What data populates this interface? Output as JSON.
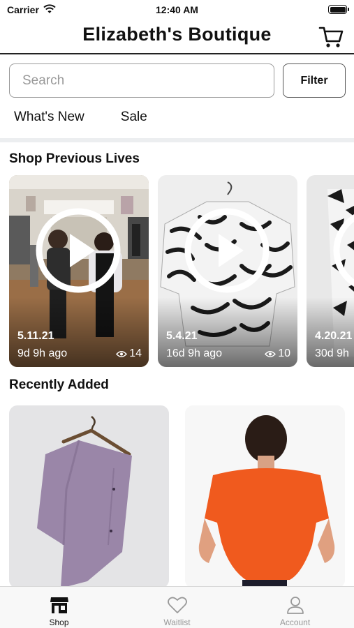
{
  "status_bar": {
    "carrier": "Carrier",
    "time": "12:40 AM"
  },
  "header": {
    "title": "Elizabeth's Boutique",
    "cart_icon": "cart-icon"
  },
  "search": {
    "placeholder": "Search",
    "filter_label": "Filter"
  },
  "top_tabs": [
    {
      "label": "What's New"
    },
    {
      "label": "Sale"
    }
  ],
  "previous_lives": {
    "title": "Shop Previous Lives",
    "items": [
      {
        "date": "5.11.21",
        "ago": "9d 9h ago",
        "views": "14"
      },
      {
        "date": "5.4.21",
        "ago": "16d 9h ago",
        "views": "10"
      },
      {
        "date": "4.20.21",
        "ago": "30d 9h",
        "views": ""
      }
    ]
  },
  "recently_added": {
    "title": "Recently Added"
  },
  "tab_bar": {
    "items": [
      {
        "label": "Shop",
        "icon": "shop-icon",
        "active": true
      },
      {
        "label": "Waitlist",
        "icon": "heart-icon",
        "active": false
      },
      {
        "label": "Account",
        "icon": "account-icon",
        "active": false
      }
    ]
  },
  "colors": {
    "accent": "#111111",
    "inactive": "#999999",
    "divider": "#eceef0",
    "product_orange": "#f05a1e",
    "product_lavender": "#9a86a8"
  }
}
